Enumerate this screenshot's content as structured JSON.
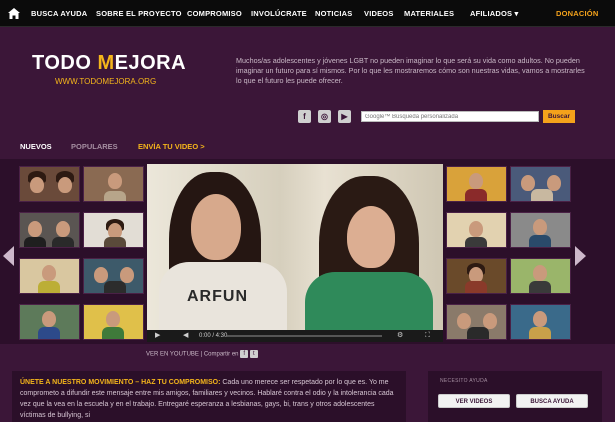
{
  "nav": {
    "items": [
      "BUSCA AYUDA",
      "SOBRE EL PROYECTO",
      "COMPROMISO",
      "INVOLÚCRATE",
      "NOTICIAS",
      "VIDEOS",
      "MATERIALES",
      "AFILIADOS ▾"
    ],
    "donate": "DONACIÓN"
  },
  "header": {
    "logo_part1": "TODO ",
    "logo_m": "M",
    "logo_part2": "EJORA",
    "url": "WWW.TODOMEJORA.ORG",
    "intro": "Muchos/as adolescentes y jóvenes LGBT no pueden imaginar lo que será su vida como adultos. No pueden imaginar un futuro para sí mismos. Por lo que les mostraremos cómo son nuestras vidas, vamos a mostrarles lo que el futuro les puede ofrecer."
  },
  "social": {
    "facebook": "f",
    "instagram": "◎",
    "youtube": "▶"
  },
  "search": {
    "placeholder": "Google™ Búsqueda personalizada",
    "button": "Buscar"
  },
  "tabs": {
    "new": "NUEVOS",
    "popular": "POPULARES",
    "submit": "ENVÍA TU VIDEO >"
  },
  "player": {
    "shirt_text": "ARFUN",
    "time": "0:00 / 4:30",
    "play": "▶",
    "volume": "◀",
    "settings": "⚙",
    "fullscreen": "⛶"
  },
  "share": {
    "youtube_link": "VER EN YOUTUBE",
    "separator": " | ",
    "share_label": "Compartir en",
    "fb": "f",
    "tw": "t"
  },
  "pledge": {
    "title": "ÚNETE A NUESTRO MOVIMIENTO – HAZ TU COMPROMISO:",
    "text": " Cada uno merece ser respetado por lo que es. Yo me comprometo a difundir este mensaje entre mis amigos, familiares y vecinos. Hablaré contra el odio y la intolerancia cada vez que la vea en la escuela y en el trabajo. Entregaré esperanza a lesbianas, gays, bi, trans y otros adolescentes víctimas de bullying, si"
  },
  "aside": {
    "title": "NECESITO AYUDA",
    "btn_videos": "VER VIDEOS",
    "btn_help": "BUSCA AYUDA"
  },
  "colors": {
    "background": "#3b1638",
    "accent": "#f4b51b",
    "donate": "#f4a21b"
  }
}
